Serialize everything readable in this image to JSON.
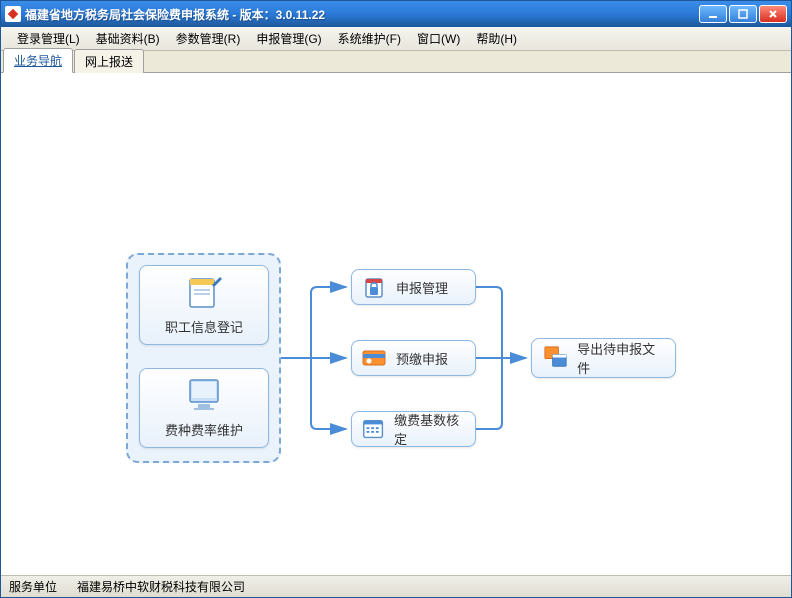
{
  "titlebar": {
    "text": "福建省地方税务局社会保险费申报系统 - 版本：3.0.11.22"
  },
  "menu": {
    "items": [
      "登录管理(L)",
      "基础资料(B)",
      "参数管理(R)",
      "申报管理(G)",
      "系统维护(F)",
      "窗口(W)",
      "帮助(H)"
    ]
  },
  "tabs": {
    "items": [
      "业务导航",
      "网上报送"
    ],
    "active": 0
  },
  "flow": {
    "employee_register": "职工信息登记",
    "fee_rate": "费种费率维护",
    "declare_manage": "申报管理",
    "prepay": "预缴申报",
    "base_verify": "缴费基数核定",
    "export": "导出待申报文件"
  },
  "statusbar": {
    "label": "服务单位",
    "company": "福建易桥中软财税科技有限公司"
  }
}
